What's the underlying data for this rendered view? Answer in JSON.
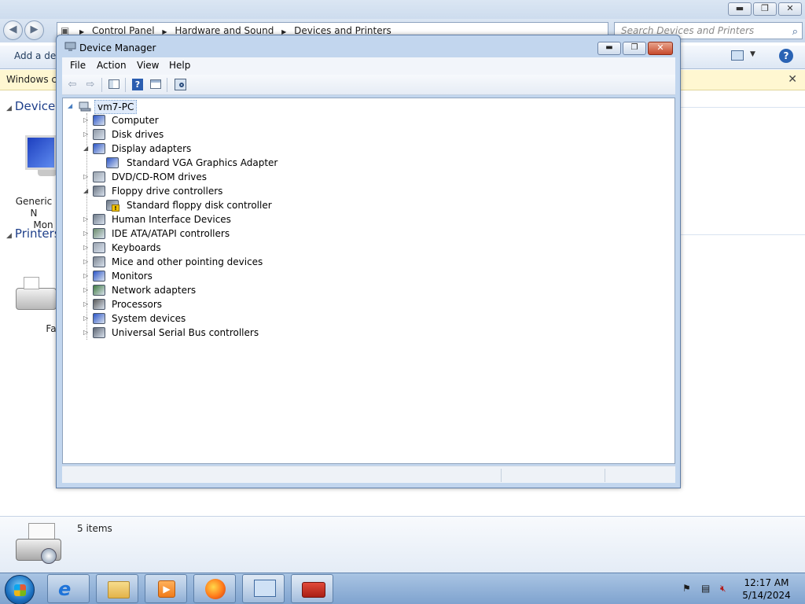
{
  "explorer": {
    "address_crumbs": [
      "Control Panel",
      "Hardware and Sound",
      "Devices and Printers"
    ],
    "search_placeholder": "Search Devices and Printers",
    "command_add_device": "Add a dev",
    "infobar_text": "Windows ca",
    "groups": {
      "devices": "Devices",
      "printers": "Printers"
    },
    "device_label_line1": "Generic N",
    "device_label_line2": "Mon",
    "printer_label": "Fa",
    "items_count": "5 items"
  },
  "device_manager": {
    "title": "Device Manager",
    "menu": [
      "File",
      "Action",
      "View",
      "Help"
    ],
    "tree": {
      "root": "vm7-PC",
      "items": [
        {
          "label": "Computer",
          "expanded": false,
          "icon": "computer-icon"
        },
        {
          "label": "Disk drives",
          "expanded": false,
          "icon": "disk-drive-icon"
        },
        {
          "label": "Display adapters",
          "expanded": true,
          "icon": "display-adapter-icon",
          "children": [
            {
              "label": "Standard VGA Graphics Adapter",
              "icon": "display-adapter-icon"
            }
          ]
        },
        {
          "label": "DVD/CD-ROM drives",
          "expanded": false,
          "icon": "dvd-drive-icon"
        },
        {
          "label": "Floppy drive controllers",
          "expanded": true,
          "icon": "floppy-controller-icon",
          "children": [
            {
              "label": "Standard floppy disk controller",
              "icon": "floppy-warning-icon"
            }
          ]
        },
        {
          "label": "Human Interface Devices",
          "expanded": false,
          "icon": "hid-icon"
        },
        {
          "label": "IDE ATA/ATAPI controllers",
          "expanded": false,
          "icon": "ide-controller-icon"
        },
        {
          "label": "Keyboards",
          "expanded": false,
          "icon": "keyboard-icon"
        },
        {
          "label": "Mice and other pointing devices",
          "expanded": false,
          "icon": "mouse-icon"
        },
        {
          "label": "Monitors",
          "expanded": false,
          "icon": "monitor-icon"
        },
        {
          "label": "Network adapters",
          "expanded": false,
          "icon": "network-adapter-icon"
        },
        {
          "label": "Processors",
          "expanded": false,
          "icon": "processor-icon"
        },
        {
          "label": "System devices",
          "expanded": false,
          "icon": "system-devices-icon"
        },
        {
          "label": "Universal Serial Bus controllers",
          "expanded": false,
          "icon": "usb-icon"
        }
      ]
    }
  },
  "taskbar": {
    "time": "12:17 AM",
    "date": "5/14/2024",
    "buttons": [
      "internet-explorer-icon",
      "file-explorer-icon",
      "media-player-icon",
      "firefox-icon",
      "devices-printers-icon",
      "toolbox-icon"
    ]
  },
  "colors": {
    "accent": "#1e3f8a",
    "warning": "#f2c300"
  }
}
